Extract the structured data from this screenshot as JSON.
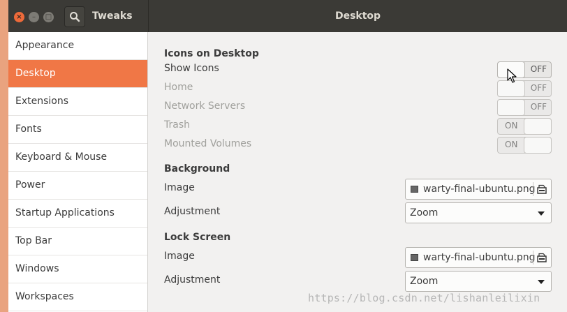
{
  "app": {
    "title": "Tweaks",
    "page_title": "Desktop"
  },
  "icons": {
    "close": "close-icon",
    "minimize": "minimize-icon",
    "maximize": "maximize-icon",
    "search": "search-icon",
    "file": "image-file-icon",
    "open": "open-folder-icon",
    "dropdown": "dropdown-arrow-icon",
    "cursor": "mouse-pointer-icon"
  },
  "colors": {
    "accent": "#f07746",
    "titlebar": "#3b3a36",
    "window_bg": "#f2f1f0"
  },
  "sidebar": {
    "items": [
      {
        "label": "Appearance",
        "active": false
      },
      {
        "label": "Desktop",
        "active": true
      },
      {
        "label": "Extensions",
        "active": false
      },
      {
        "label": "Fonts",
        "active": false
      },
      {
        "label": "Keyboard & Mouse",
        "active": false
      },
      {
        "label": "Power",
        "active": false
      },
      {
        "label": "Startup Applications",
        "active": false
      },
      {
        "label": "Top Bar",
        "active": false
      },
      {
        "label": "Windows",
        "active": false
      },
      {
        "label": "Workspaces",
        "active": false
      }
    ]
  },
  "icons_section": {
    "heading": "Icons on Desktop",
    "rows": [
      {
        "label": "Show Icons",
        "state": "OFF",
        "enabled": true
      },
      {
        "label": "Home",
        "state": "OFF",
        "enabled": false
      },
      {
        "label": "Network Servers",
        "state": "OFF",
        "enabled": false
      },
      {
        "label": "Trash",
        "state": "ON",
        "enabled": false
      },
      {
        "label": "Mounted Volumes",
        "state": "ON",
        "enabled": false
      }
    ]
  },
  "background": {
    "heading": "Background",
    "image_label": "Image",
    "image_value": "warty-final-ubuntu.png",
    "adjustment_label": "Adjustment",
    "adjustment_value": "Zoom"
  },
  "lock_screen": {
    "heading": "Lock Screen",
    "image_label": "Image",
    "image_value": "warty-final-ubuntu.png",
    "adjustment_label": "Adjustment",
    "adjustment_value": "Zoom"
  },
  "watermark": "https://blog.csdn.net/lishanleilixin"
}
